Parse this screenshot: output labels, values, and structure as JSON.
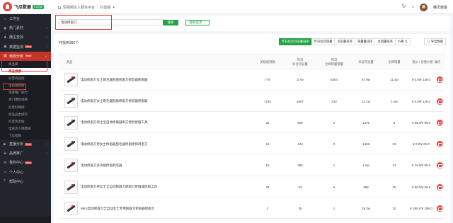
{
  "app": {
    "logo_text": "飞瓜数据",
    "logo_badge": "抖音版"
  },
  "header": {
    "crumbs": [
      "短视频达人服务平台",
      "抖音版"
    ],
    "username": "精灵旅客"
  },
  "sidebar": {
    "items": [
      {
        "label": "工作台",
        "icon": "⌂"
      },
      {
        "label": "热门素材",
        "icon": "◉"
      },
      {
        "label": "播主查找",
        "icon": "♟"
      },
      {
        "label": "数据监测",
        "icon": "▣",
        "badge": "New"
      },
      {
        "label": "电商分析",
        "icon": "▤",
        "badge": "New",
        "active": true
      }
    ],
    "sub_items": [
      "商品库",
      "商品搜索",
      "抖音商品榜",
      "电商视频榜",
      "淘客推广排行",
      "热门爆款视频",
      "抖音好物榜",
      "商品品类排行",
      "抖音热卖榜",
      "电商达人销量榜",
      "飞瓜指数"
    ],
    "current_sub": "商品搜索",
    "bottom_items": [
      {
        "label": "直播分析",
        "icon": "▶",
        "badge": "New"
      },
      {
        "label": "品牌推广",
        "icon": "♛"
      },
      {
        "label": "我的中心",
        "icon": "✉",
        "badge": "New"
      },
      {
        "label": "个人中心",
        "icon": "☺"
      },
      {
        "label": "帮助中心",
        "icon": "?"
      }
    ]
  },
  "search": {
    "value": "电动修眉刀",
    "button": "搜索",
    "filter_button": "搜索选项"
  },
  "results": {
    "count_text": "共找到392个",
    "sort_tabs": [
      "昨日抖音浏览量排序",
      "昨日抖音销量",
      "浏览量排序",
      "销量量排序",
      "总销量排序",
      "价格"
    ],
    "active_tab": 0,
    "export": "导出数据",
    "columns": [
      "商品",
      "关联视频数",
      "昨日\n抖音浏览量",
      "昨日\n全网销量增量",
      "抖音浏览量",
      "全网销量",
      "售价 / 优惠价格",
      "操作"
    ],
    "rows": [
      {
        "name": "电动修眉刀女士剃毛器刮眉修眉刀修剪器修眉器",
        "videos": "778",
        "views_y": "3.7w",
        "sales_y": "5364",
        "views": "87.9w",
        "sales": "11.4w",
        "price": "¥ 0.0",
        "price_orig": "¥ 139.0"
      },
      {
        "name": "电动修眉刀女士剃毛器刮眉修眉刀修剪器修眉器",
        "videos": "7240",
        "views_y": "2087",
        "sales_y": "233",
        "views": "14.1w",
        "sales": "1.0w",
        "price": "¥ 0.0",
        "price_orig": "¥ 129.0"
      },
      {
        "name": "电动修眉刀男士全自动修眉器剃刀修剪修眉工具",
        "videos": "26",
        "views_y": "569",
        "sales_y": "0",
        "views": "1476",
        "sales": "8",
        "price": "¥ 59.0",
        "price_orig": "¥ 99.0"
      },
      {
        "name": "电动修眉刀男女士修眉器刮毛器修眉修剪剃毛刀",
        "videos": "61",
        "views_y": "444",
        "sales_y": "0",
        "views": "1438",
        "sales": "63",
        "price": "¥ 0.0",
        "price_orig": "¥ 29.0"
      },
      {
        "name": "电动修眉刀多功能修眉剃毛器",
        "videos": "19",
        "views_y": "380",
        "sales_y": "1",
        "views": "1.0w",
        "sales": "13",
        "price": "¥ 79.0",
        "price_orig": "¥ 99.0"
      },
      {
        "name": "电动修眉刀男女士全自动刮眉刀剃眉刀修眉器修眉工具",
        "videos": "29",
        "views_y": "63",
        "sales_y": "9",
        "views": "389",
        "sales": "25",
        "price": "¥ 99.0",
        "price_orig": "¥ 36.0"
      },
      {
        "name": "MKS电动修眉刀全自动女士专用刮眉刀修眉器修眉刀",
        "videos": "2",
        "views_y": "35",
        "sales_y": "1",
        "views": "29.3w",
        "sales": "10",
        "price": "¥ 399.0",
        "price_orig": "¥ 199.0"
      }
    ]
  },
  "colors": {
    "accent_red": "#c0342a",
    "brand_green": "#25a244",
    "sidebar_bg": "#22252c"
  }
}
